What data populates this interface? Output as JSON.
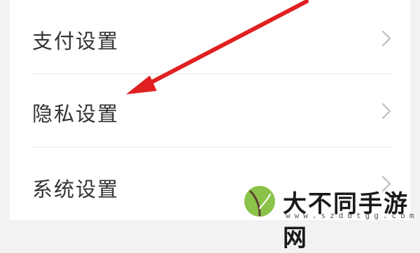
{
  "settings": {
    "items": [
      {
        "label": "支付设置"
      },
      {
        "label": "隐私设置"
      },
      {
        "label": "系统设置"
      }
    ]
  },
  "annotation": {
    "color": "#e02020",
    "icon": "red-arrow-pointer"
  },
  "watermark": {
    "title": "大不同手游网",
    "url": "www.szdbtgg.com",
    "logo_icon": "leaf-logo",
    "logo_color": "#7cb342"
  }
}
